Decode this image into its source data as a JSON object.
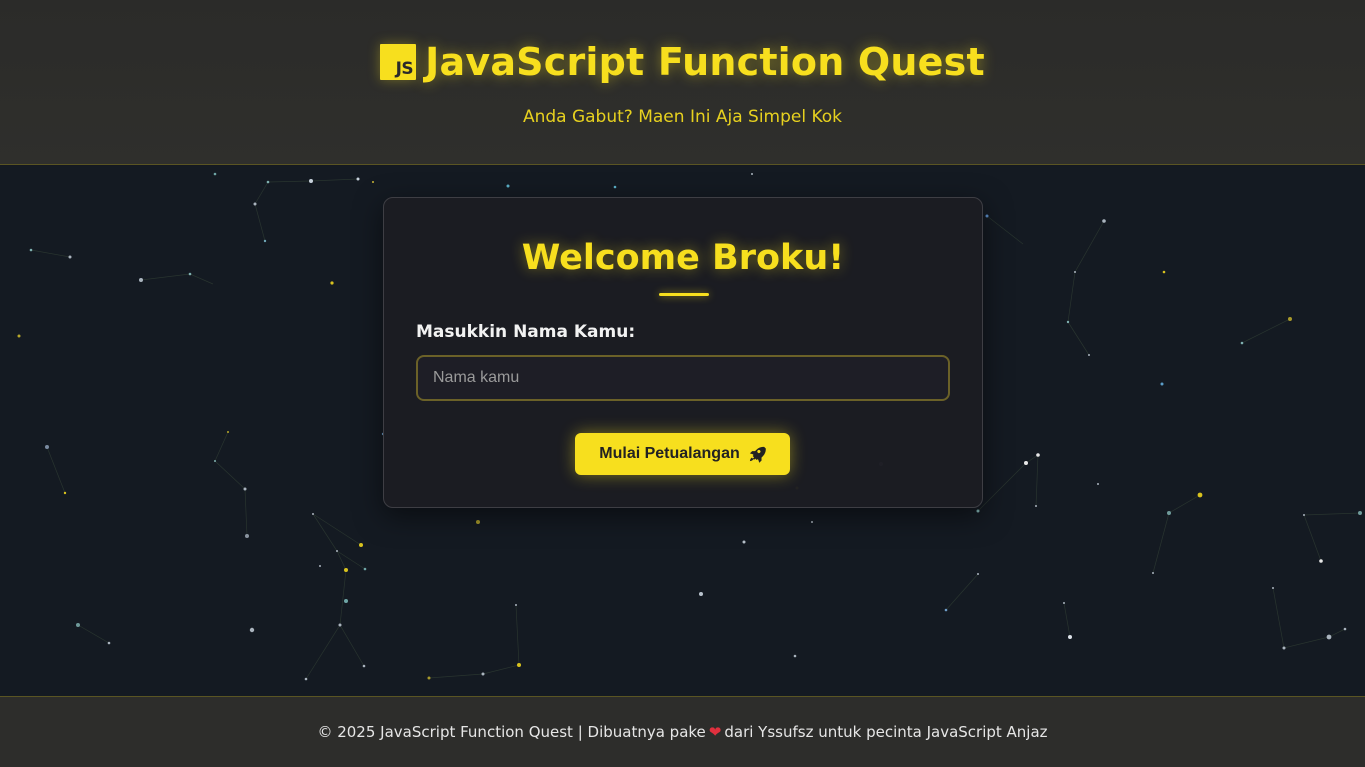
{
  "header": {
    "logo_text": "JS",
    "title": "JavaScript Function Quest",
    "subtitle": "Anda Gabut? Maen Ini Aja Simpel Kok"
  },
  "card": {
    "welcome": "Welcome Broku!",
    "name_label": "Masukkin Nama Kamu:",
    "name_value": "",
    "name_placeholder": "Nama kamu",
    "start_button_label": "Mulai Petualangan",
    "start_button_icon": "rocket-icon"
  },
  "footer": {
    "text_before": "© 2025 JavaScript Function Quest | Dibuatnya pake",
    "heart_icon": "heart-icon",
    "text_after": "dari Yssufsz untuk pecinta JavaScript Anjaz"
  },
  "colors": {
    "accent": "#f7df1e",
    "background": "#141a22",
    "header_bg": "#2d2d2b",
    "card_bg": "#1c1c22",
    "heart": "#e0303e"
  }
}
